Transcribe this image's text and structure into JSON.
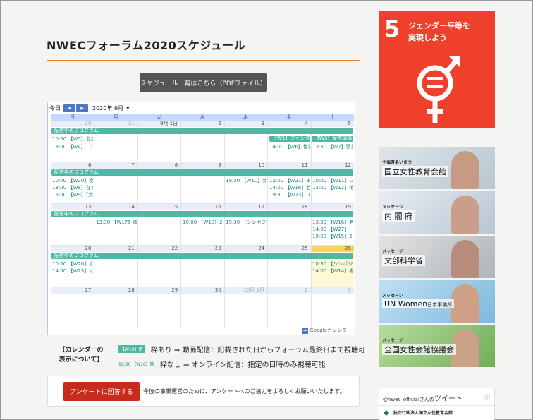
{
  "page": {
    "title": "NWECフォーラム2020スケジュール",
    "pdf_button": "スケジュール一覧はこちら（PDFファイル）"
  },
  "calendar": {
    "today_label": "今日",
    "prev_icon": "◀",
    "next_icon": "▶",
    "month": "2020年 9月",
    "dropdown_icon": "▼",
    "weekdays": [
      "日",
      "月",
      "火",
      "水",
      "木",
      "金",
      "土"
    ],
    "weeks": [
      {
        "days": [
          "30",
          "31",
          "9月 1日",
          "2",
          "3",
          "4",
          "5"
        ],
        "bar": "配信中のプログラム",
        "bar2": [
          "【W1】ジェンダ",
          "【W3】女性議員"
        ],
        "events": [
          "10:00 【W5】北京",
          "13:00 【W4】コロ",
          "14:00 【W6】世界",
          "13:30 【W7】緊急"
        ]
      },
      {
        "days": [
          "6",
          "7",
          "8",
          "9",
          "10",
          "11",
          "12"
        ],
        "bar": "配信中のプログラム",
        "events": [
          "10:00 【W20】女",
          "13:00 【W8】在宅",
          "15:00 【W9】「女",
          "19:30 【W10】新",
          "12:00 【W21】未",
          "14:00 【W16】若",
          "19:30 【W23】DV",
          "10:00 【W11】ユ",
          "13:00 【W12】地"
        ]
      },
      {
        "days": [
          "13",
          "14",
          "15",
          "16",
          "17",
          "18",
          "19"
        ],
        "bar": "配信中のプログラム",
        "events": [
          "13:30 【W17】映",
          "10:00 【W13】20",
          "19:30 【シンポジウ",
          "13:30 【W16】若",
          "14:00 【W27】「",
          "19:00 【W15】20"
        ]
      },
      {
        "days": [
          "20",
          "21",
          "22",
          "23",
          "24",
          "25",
          "26"
        ],
        "bar": "配信中のプログラム",
        "events": [
          "10:00 【W20】女",
          "14:00 【W25】オ",
          "10:30 【シンポジ",
          "14:00 【W14】考"
        ]
      },
      {
        "days": [
          "27",
          "28",
          "29",
          "30",
          "10月 1日",
          "2",
          "3"
        ]
      }
    ],
    "footer": "Googleカレンダー",
    "footer_icon": "+"
  },
  "legend": {
    "title": "【カレンダーの\n表示について】",
    "rows": [
      {
        "sample": "【W10】新",
        "text": "枠あり ⇒ 動画配信：記載された日からフォーラム最終日まで視聴可"
      },
      {
        "sample": "19:30 【W10】新",
        "text": "枠なし ⇒ オンライン配信：指定の日時のみ視聴可能"
      }
    ]
  },
  "survey": {
    "button": "アンケートに回答する",
    "text": "今後の事業運営のために、アンケートへのご協力をよろしくお願いいたします。"
  },
  "sdg": {
    "number": "5",
    "text": "ジェンダー平等を\n実現しよう",
    "icon": "gender-equality-icon",
    "color": "#ef402b"
  },
  "banners": [
    {
      "label": "主催者あいさつ",
      "org": "国立女性教育会館",
      "suffix": ""
    },
    {
      "label": "メッセージ",
      "org": "内 閣 府",
      "suffix": ""
    },
    {
      "label": "メッセージ",
      "org": "文部科学省",
      "suffix": ""
    },
    {
      "label": "メッセージ",
      "org": "UN Women",
      "suffix": "日本事務所"
    },
    {
      "label": "メッセージ",
      "org": "全国女性会館協議会",
      "suffix": ""
    }
  ],
  "twitter": {
    "handle": "@nwec_officialさんの",
    "heading": "ツイート",
    "info_icon": "ⓘ",
    "account": "独立行政法人国立女性教育会館"
  }
}
